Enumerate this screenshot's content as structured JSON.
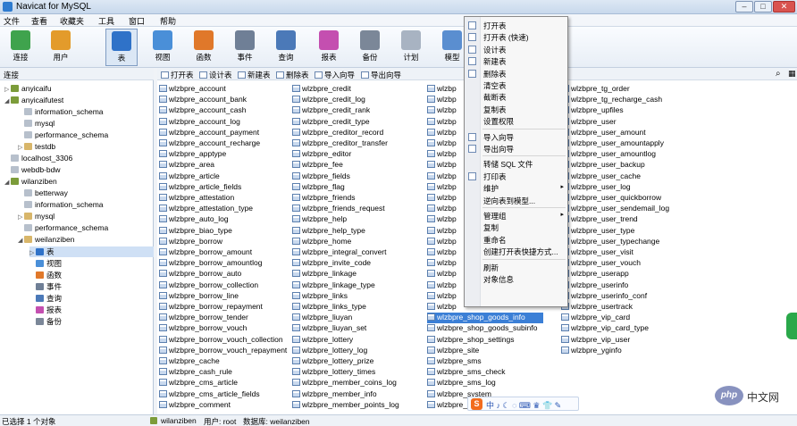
{
  "window": {
    "title": "Navicat for MySQL",
    "controls": [
      "–",
      "□",
      "✕"
    ]
  },
  "menubar": [
    "文件",
    "查看",
    "收藏夹",
    "工具",
    "窗口",
    "帮助"
  ],
  "toolbar": [
    {
      "label": "连接",
      "color": "#3fa34d"
    },
    {
      "label": "用户",
      "color": "#e39b2b"
    },
    {
      "label": "表",
      "color": "#2f72c8"
    },
    {
      "label": "视图",
      "color": "#4a8fd8"
    },
    {
      "label": "函数",
      "color": "#e0782a"
    },
    {
      "label": "事件",
      "color": "#6f7f96"
    },
    {
      "label": "查询",
      "color": "#4b79b8"
    },
    {
      "label": "报表",
      "color": "#c44fb0"
    },
    {
      "label": "备份",
      "color": "#7b8798"
    },
    {
      "label": "计划",
      "color": "#a8b3c2"
    },
    {
      "label": "模型",
      "color": "#5a8ed0"
    }
  ],
  "left_pane": {
    "header": "连接",
    "tree": [
      {
        "label": "anyicaifu",
        "ex": "▷",
        "color": "#7c9c3a"
      },
      {
        "label": "anyicaifutest",
        "ex": "◢",
        "color": "#7c9c3a"
      },
      {
        "label": "information_schema",
        "ex": "",
        "color": "#b7c0cc"
      },
      {
        "label": "mysql",
        "ex": "",
        "color": "#b7c0cc"
      },
      {
        "label": "performance_schema",
        "ex": "",
        "color": "#b7c0cc"
      },
      {
        "label": "testdb",
        "ex": "▷",
        "color": "#d8b66a"
      },
      {
        "label": "localhost_3306",
        "ex": "",
        "color": "#b7c0cc"
      },
      {
        "label": "webdb-bdw",
        "ex": "",
        "color": "#b7c0cc"
      },
      {
        "label": "wilanziben",
        "ex": "◢",
        "color": "#7c9c3a"
      },
      {
        "label": "betterway",
        "ex": "",
        "color": "#b7c0cc"
      },
      {
        "label": "information_schema",
        "ex": "",
        "color": "#b7c0cc"
      },
      {
        "label": "mysql",
        "ex": "▷",
        "color": "#d8b66a"
      },
      {
        "label": "performance_schema",
        "ex": "",
        "color": "#b7c0cc"
      },
      {
        "label": "weilanziben",
        "ex": "◢",
        "color": "#d8b66a"
      },
      {
        "label": "表",
        "ex": "▷",
        "color": "#2f72c8"
      },
      {
        "label": "视图",
        "ex": "",
        "color": "#4a8fd8"
      },
      {
        "label": "函数",
        "ex": "",
        "color": "#e0782a"
      },
      {
        "label": "事件",
        "ex": "",
        "color": "#6f7f96"
      },
      {
        "label": "查询",
        "ex": "",
        "color": "#4b79b8"
      },
      {
        "label": "报表",
        "ex": "",
        "color": "#c44fb0"
      },
      {
        "label": "备份",
        "ex": "",
        "color": "#7b8798"
      }
    ]
  },
  "object_toolbar": [
    "打开表",
    "设计表",
    "新建表",
    "删除表",
    "导入向导",
    "导出向导"
  ],
  "tables": {
    "columns": [
      [
        "wlzbpre_account",
        "wlzbpre_account_bank",
        "wlzbpre_account_cash",
        "wlzbpre_account_log",
        "wlzbpre_account_payment",
        "wlzbpre_account_recharge",
        "wlzbpre_apptype",
        "wlzbpre_area",
        "wlzbpre_article",
        "wlzbpre_article_fields",
        "wlzbpre_attestation",
        "wlzbpre_attestation_type",
        "wlzbpre_auto_log",
        "wlzbpre_biao_type",
        "wlzbpre_borrow",
        "wlzbpre_borrow_amount",
        "wlzbpre_borrow_amountlog",
        "wlzbpre_borrow_auto",
        "wlzbpre_borrow_collection",
        "wlzbpre_borrow_line",
        "wlzbpre_borrow_repayment",
        "wlzbpre_borrow_tender",
        "wlzbpre_borrow_vouch",
        "wlzbpre_borrow_vouch_collection",
        "wlzbpre_borrow_vouch_repayment",
        "wlzbpre_cache",
        "wlzbpre_cash_rule",
        "wlzbpre_cms_article",
        "wlzbpre_cms_article_fields",
        "wlzbpre_comment"
      ],
      [
        "wlzbpre_credit",
        "wlzbpre_credit_log",
        "wlzbpre_credit_rank",
        "wlzbpre_credit_type",
        "wlzbpre_creditor_record",
        "wlzbpre_creditor_transfer",
        "wlzbpre_editor",
        "wlzbpre_fee",
        "wlzbpre_fields",
        "wlzbpre_flag",
        "wlzbpre_friends",
        "wlzbpre_friends_request",
        "wlzbpre_help",
        "wlzbpre_help_type",
        "wlzbpre_home",
        "wlzbpre_integral_convert",
        "wlzbpre_invite_code",
        "wlzbpre_linkage",
        "wlzbpre_linkage_type",
        "wlzbpre_links",
        "wlzbpre_links_type",
        "wlzbpre_liuyan",
        "wlzbpre_liuyan_set",
        "wlzbpre_lottery",
        "wlzbpre_lottery_log",
        "wlzbpre_lottery_prize",
        "wlzbpre_lottery_times",
        "wlzbpre_member_coins_log",
        "wlzbpre_member_info",
        "wlzbpre_member_points_log"
      ],
      [
        "wlzbp",
        "wlzbp",
        "wlzbp",
        "wlzbp",
        "wlzbp",
        "wlzbp",
        "wlzbp",
        "wlzbp",
        "wlzbp",
        "wlzbp",
        "wlzbp",
        "wlzbp",
        "wlzbp",
        "wlzbp",
        "wlzbp",
        "wlzbp",
        "wlzbp",
        "wlzbp",
        "wlzbp",
        "wlzbp",
        "wlzbp",
        "wlzbpre_shop_goods_info",
        "wlzbpre_shop_goods_subinfo",
        "wlzbpre_shop_settings",
        "wlzbpre_site",
        "wlzbpre_sms",
        "wlzbpre_sms_check",
        "wlzbpre_sms_log",
        "wlzbpre_system",
        "wlzbpre_tg_error"
      ],
      [
        "wlzbpre_tg_order",
        "wlzbpre_tg_recharge_cash",
        "wlzbpre_upfiles",
        "wlzbpre_user",
        "wlzbpre_user_amount",
        "wlzbpre_user_amountapply",
        "wlzbpre_user_amountlog",
        "wlzbpre_user_backup",
        "wlzbpre_user_cache",
        "wlzbpre_user_log",
        "wlzbpre_user_quickborrow",
        "wlzbpre_user_sendemail_log",
        "wlzbpre_user_trend",
        "wlzbpre_user_type",
        "wlzbpre_user_typechange",
        "wlzbpre_user_visit",
        "wlzbpre_user_vouch",
        "wlzbpre_userapp",
        "wlzbpre_userinfo",
        "wlzbpre_userinfo_conf",
        "wlzbpre_usertrack",
        "wlzbpre_vip_card",
        "wlzbpre_vip_card_type",
        "wlzbpre_vip_user",
        "wlzbpre_yginfo"
      ]
    ],
    "selected": "wlzbpre_shop_goods_info"
  },
  "context_menu": [
    {
      "label": "打开表",
      "icon": true
    },
    {
      "label": "打开表 (快速)",
      "icon": true
    },
    {
      "label": "设计表",
      "icon": true
    },
    {
      "label": "新建表",
      "icon": true
    },
    {
      "label": "删除表",
      "icon": true
    },
    {
      "label": "清空表"
    },
    {
      "label": "截断表"
    },
    {
      "label": "复制表"
    },
    {
      "label": "设置权限",
      "sep_after": true
    },
    {
      "label": "导入向导",
      "icon": true
    },
    {
      "label": "导出向导",
      "icon": true,
      "sep_after": true
    },
    {
      "label": "转储 SQL 文件"
    },
    {
      "label": "打印表",
      "icon": true
    },
    {
      "label": "维护",
      "arrow": "▸"
    },
    {
      "label": "逆向表到模型...",
      "sep_after": true
    },
    {
      "label": "管理组",
      "arrow": "▸"
    },
    {
      "label": "复制"
    },
    {
      "label": "重命名"
    },
    {
      "label": "创建打开表快捷方式...",
      "sep_after": true
    },
    {
      "label": "刷新"
    },
    {
      "label": "对象信息"
    }
  ],
  "statusbar": {
    "left": "已选择 1 个对象",
    "db_icon": "wilanziben",
    "user": "用户: root",
    "database": "数据库: weilanziben"
  },
  "ime": {
    "logo": "S",
    "text": "中 ♪ ☾ ◌ ⌨ ♛ 👕 ✎"
  },
  "watermark": {
    "logo": "php",
    "text": "中文网"
  }
}
